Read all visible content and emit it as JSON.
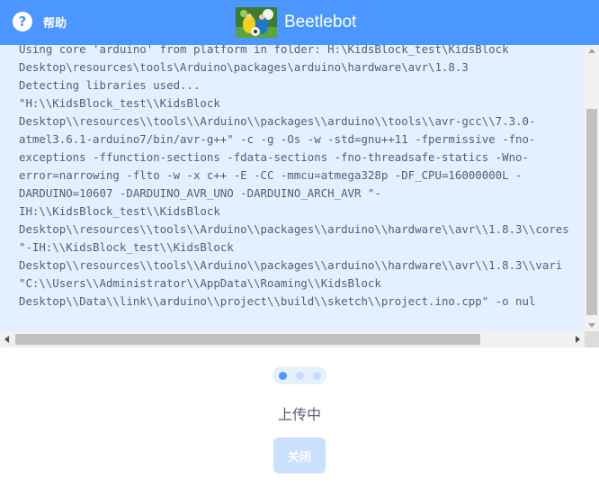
{
  "header": {
    "help_icon": "?",
    "help_label": "帮助",
    "app_title": "Beetlebot",
    "logo_icon": "beetlebot-logo-icon",
    "background_color": "#4c97ff"
  },
  "log": {
    "lines": [
      "Using core 'arduino' from platform in folder: H:\\KidsBlock_test\\KidsBlock",
      "Desktop\\resources\\tools\\Arduino\\packages\\arduino\\hardware\\avr\\1.8.3",
      "Detecting libraries used...",
      "\"H:\\\\KidsBlock_test\\\\KidsBlock",
      "Desktop\\\\resources\\\\tools\\\\Arduino\\\\packages\\\\arduino\\\\tools\\\\avr-gcc\\\\7.3.0-",
      "atmel3.6.1-arduino7/bin/avr-g++\" -c -g -Os -w -std=gnu++11 -fpermissive -fno-",
      "exceptions -ffunction-sections -fdata-sections -fno-threadsafe-statics -Wno-",
      "error=narrowing -flto -w -x c++ -E -CC -mmcu=atmega328p -DF_CPU=16000000L -",
      "DARDUINO=10607 -DARDUINO_AVR_UNO -DARDUINO_ARCH_AVR \"-",
      "IH:\\\\KidsBlock_test\\\\KidsBlock",
      "Desktop\\\\resources\\\\tools\\\\Arduino\\\\packages\\\\arduino\\\\hardware\\\\avr\\\\1.8.3\\\\cores",
      "\"-IH:\\\\KidsBlock_test\\\\KidsBlock",
      "Desktop\\\\resources\\\\tools\\\\Arduino\\\\packages\\\\arduino\\\\hardware\\\\avr\\\\1.8.3\\\\vari",
      "\"C:\\\\Users\\\\Administrator\\\\AppData\\\\Roaming\\\\KidsBlock",
      "Desktop\\\\Data\\\\link\\\\arduino\\\\project\\\\build\\\\sketch\\\\project.ino.cpp\" -o nul"
    ],
    "background_color": "#e4efff"
  },
  "progress": {
    "status_text": "上传中",
    "active_dot_color": "#4c97ff"
  },
  "close_button": {
    "label": "关闭",
    "background_color": "#cbe0fd"
  }
}
